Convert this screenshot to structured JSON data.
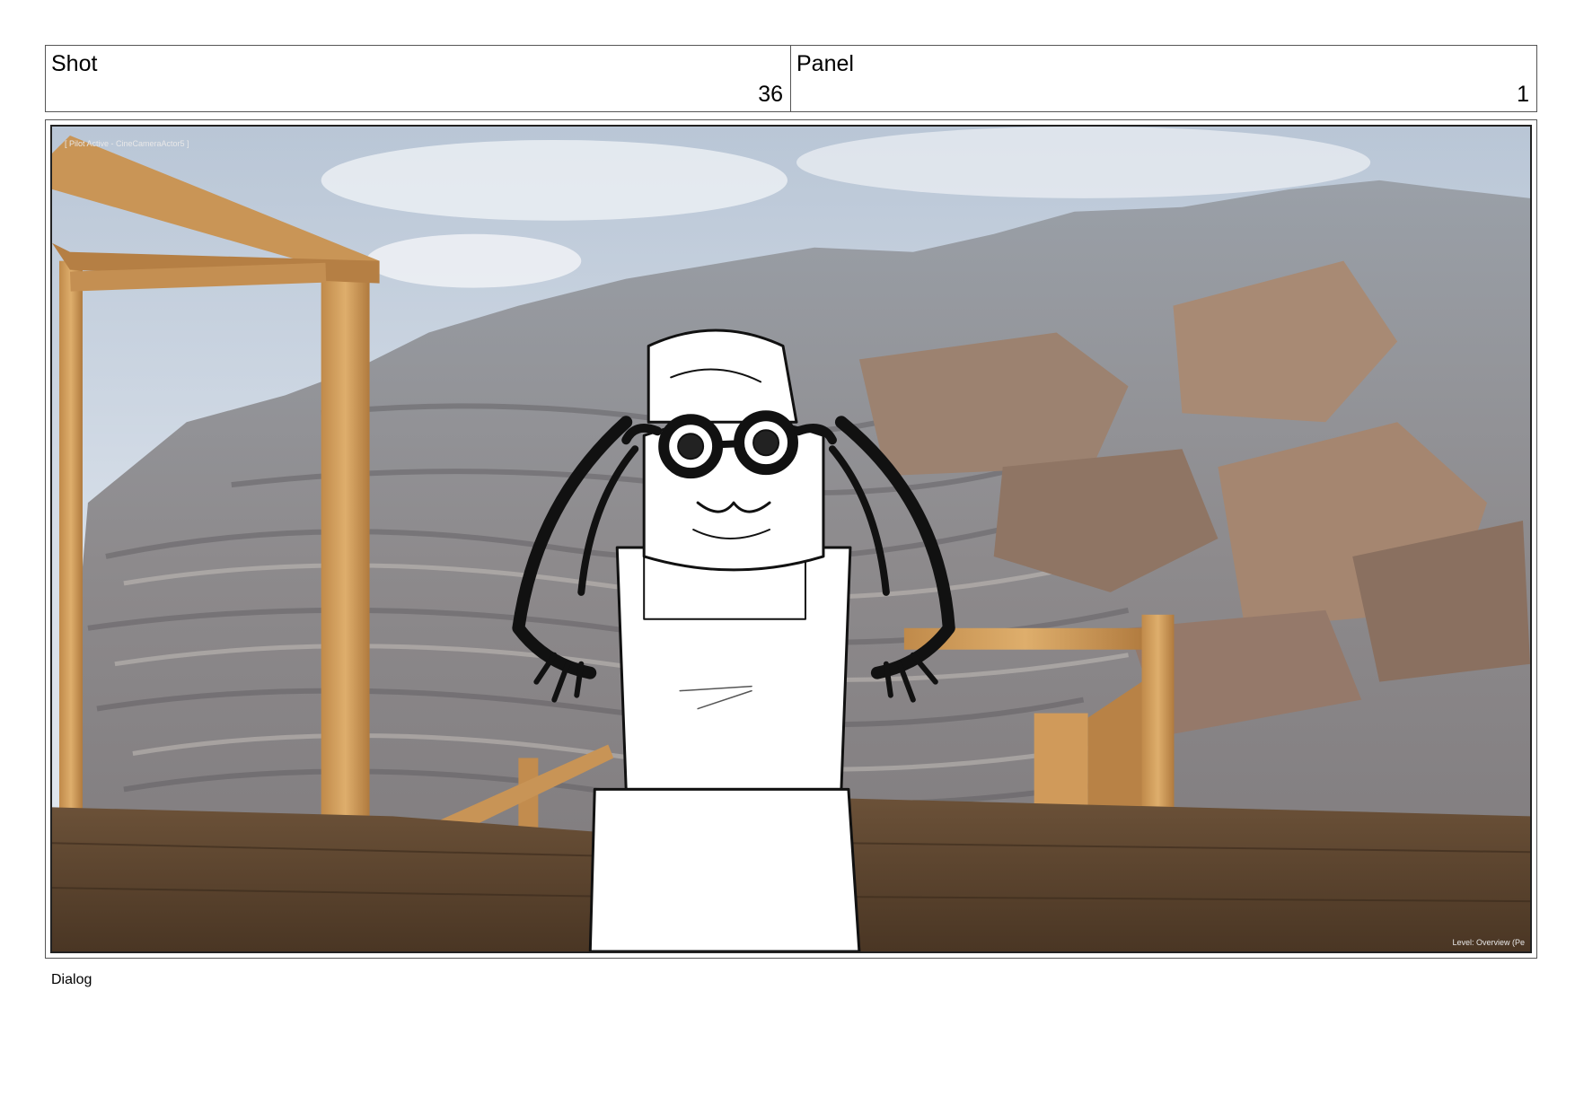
{
  "header": {
    "shot_label": "Shot",
    "shot_value": "36",
    "panel_label": "Panel",
    "panel_value": "1"
  },
  "viewport": {
    "overlay_top": "[ Pilot Active - CineCameraActor5 ]",
    "overlay_bottom": "Level: Overview (Pe"
  },
  "footer": {
    "dialog_label": "Dialog"
  }
}
